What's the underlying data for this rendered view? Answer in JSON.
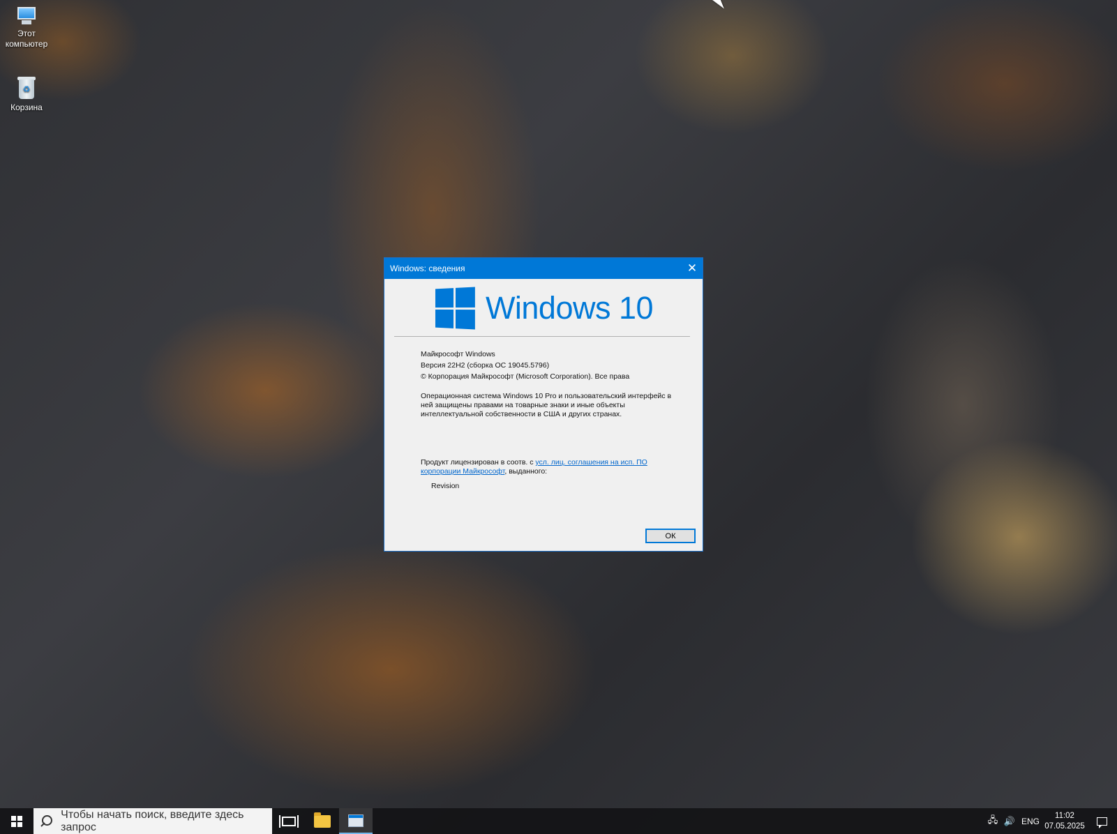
{
  "desktop": {
    "icons": [
      {
        "label": "Этот компьютер",
        "icon": "computer-icon"
      },
      {
        "label": "Корзина",
        "icon": "recycle-bin-icon"
      }
    ]
  },
  "dialog": {
    "title": "Windows: сведения",
    "logo_text": "Windows 10",
    "product": "Майкрософт Windows",
    "version": "Версия 22H2 (сборка ОС 19045.5796)",
    "copyright": "© Корпорация Майкрософт (Microsoft Corporation). Все права",
    "description": "Операционная система Windows 10 Pro и пользовательский интерфейс в ней защищены правами на товарные знаки и иные объекты интеллектуальной собственности в США и других странах.",
    "license_prefix": "Продукт лицензирован в соотв. с ",
    "license_link": "усл. лиц. соглашения на исп. ПО корпорации Майкрософт",
    "license_suffix": ", выданного:",
    "licensed_to": "Revision",
    "ok_label": "ОК"
  },
  "taskbar": {
    "search_placeholder": "Чтобы начать поиск, введите здесь запрос",
    "language": "ENG",
    "time": "11:02",
    "date": "07.05.2025"
  },
  "colors": {
    "accent": "#0078d7",
    "link": "#0066cc"
  }
}
